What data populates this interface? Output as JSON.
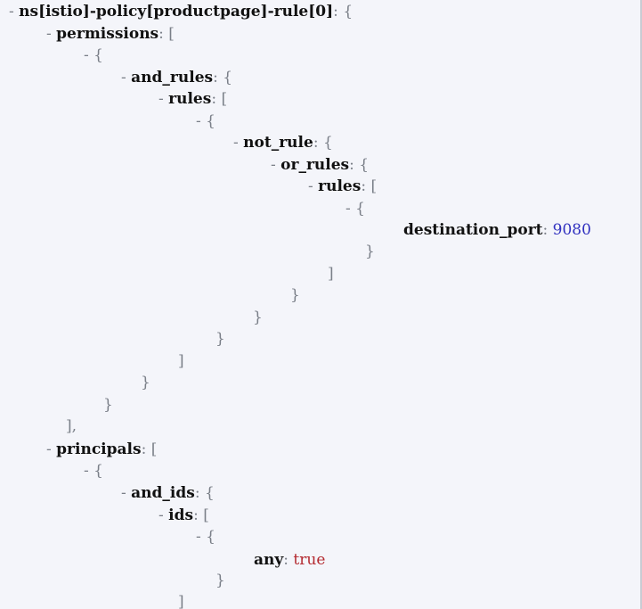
{
  "json_tree": {
    "root_key": "ns[istio]-policy[productpage]-rule[0]",
    "toggle": "-",
    "colon": ":",
    "open_brace": "{",
    "close_brace": "}",
    "open_bracket": "[",
    "close_bracket": "]",
    "close_bracket_comma": "],",
    "keys": {
      "permissions": "permissions",
      "and_rules": "and_rules",
      "rules": "rules",
      "not_rule": "not_rule",
      "or_rules": "or_rules",
      "destination_port": "destination_port",
      "principals": "principals",
      "and_ids": "and_ids",
      "ids": "ids",
      "any": "any"
    },
    "values": {
      "destination_port": "9080",
      "any": "true"
    }
  },
  "colors": {
    "background": "#f4f5fa",
    "key": "#111111",
    "punctuation": "#7a7f88",
    "number": "#2f2fbf",
    "boolean": "#b3282e"
  }
}
